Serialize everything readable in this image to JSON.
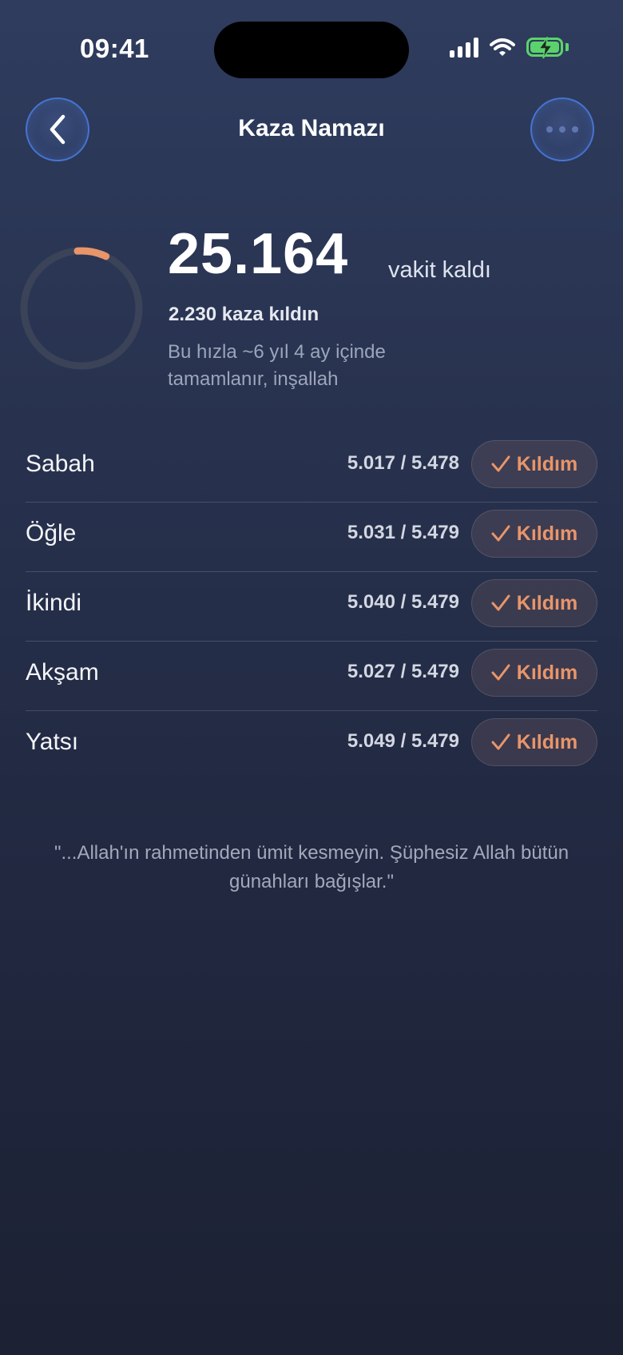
{
  "status_bar": {
    "time": "09:41"
  },
  "header": {
    "title": "Kaza Namazı"
  },
  "summary": {
    "remaining_count": "25.164",
    "remaining_label": "vakit kaldı",
    "done_text": "2.230 kaza kıldın",
    "eta_text": "Bu hızla ~6 yıl 4 ay içinde tamamlanır, inşallah",
    "progress_fraction": 0.081
  },
  "prayers": [
    {
      "name": "Sabah",
      "count": "5.017 / 5.478",
      "button": "Kıldım"
    },
    {
      "name": "Öğle",
      "count": "5.031 / 5.479",
      "button": "Kıldım"
    },
    {
      "name": "İkindi",
      "count": "5.040 / 5.479",
      "button": "Kıldım"
    },
    {
      "name": "Akşam",
      "count": "5.027 / 5.479",
      "button": "Kıldım"
    },
    {
      "name": "Yatsı",
      "count": "5.049 / 5.479",
      "button": "Kıldım"
    }
  ],
  "quote": "\"...Allah'ın rahmetinden ümit kesmeyin. Şüphesiz Allah bütün günahları bağışlar.\"",
  "colors": {
    "accent": "#e8956a",
    "ring_track": "#3a4358",
    "battery": "#5bd36b"
  },
  "icons": {
    "back": "chevron-left-icon",
    "more": "ellipsis-icon",
    "check": "checkmark-icon"
  }
}
